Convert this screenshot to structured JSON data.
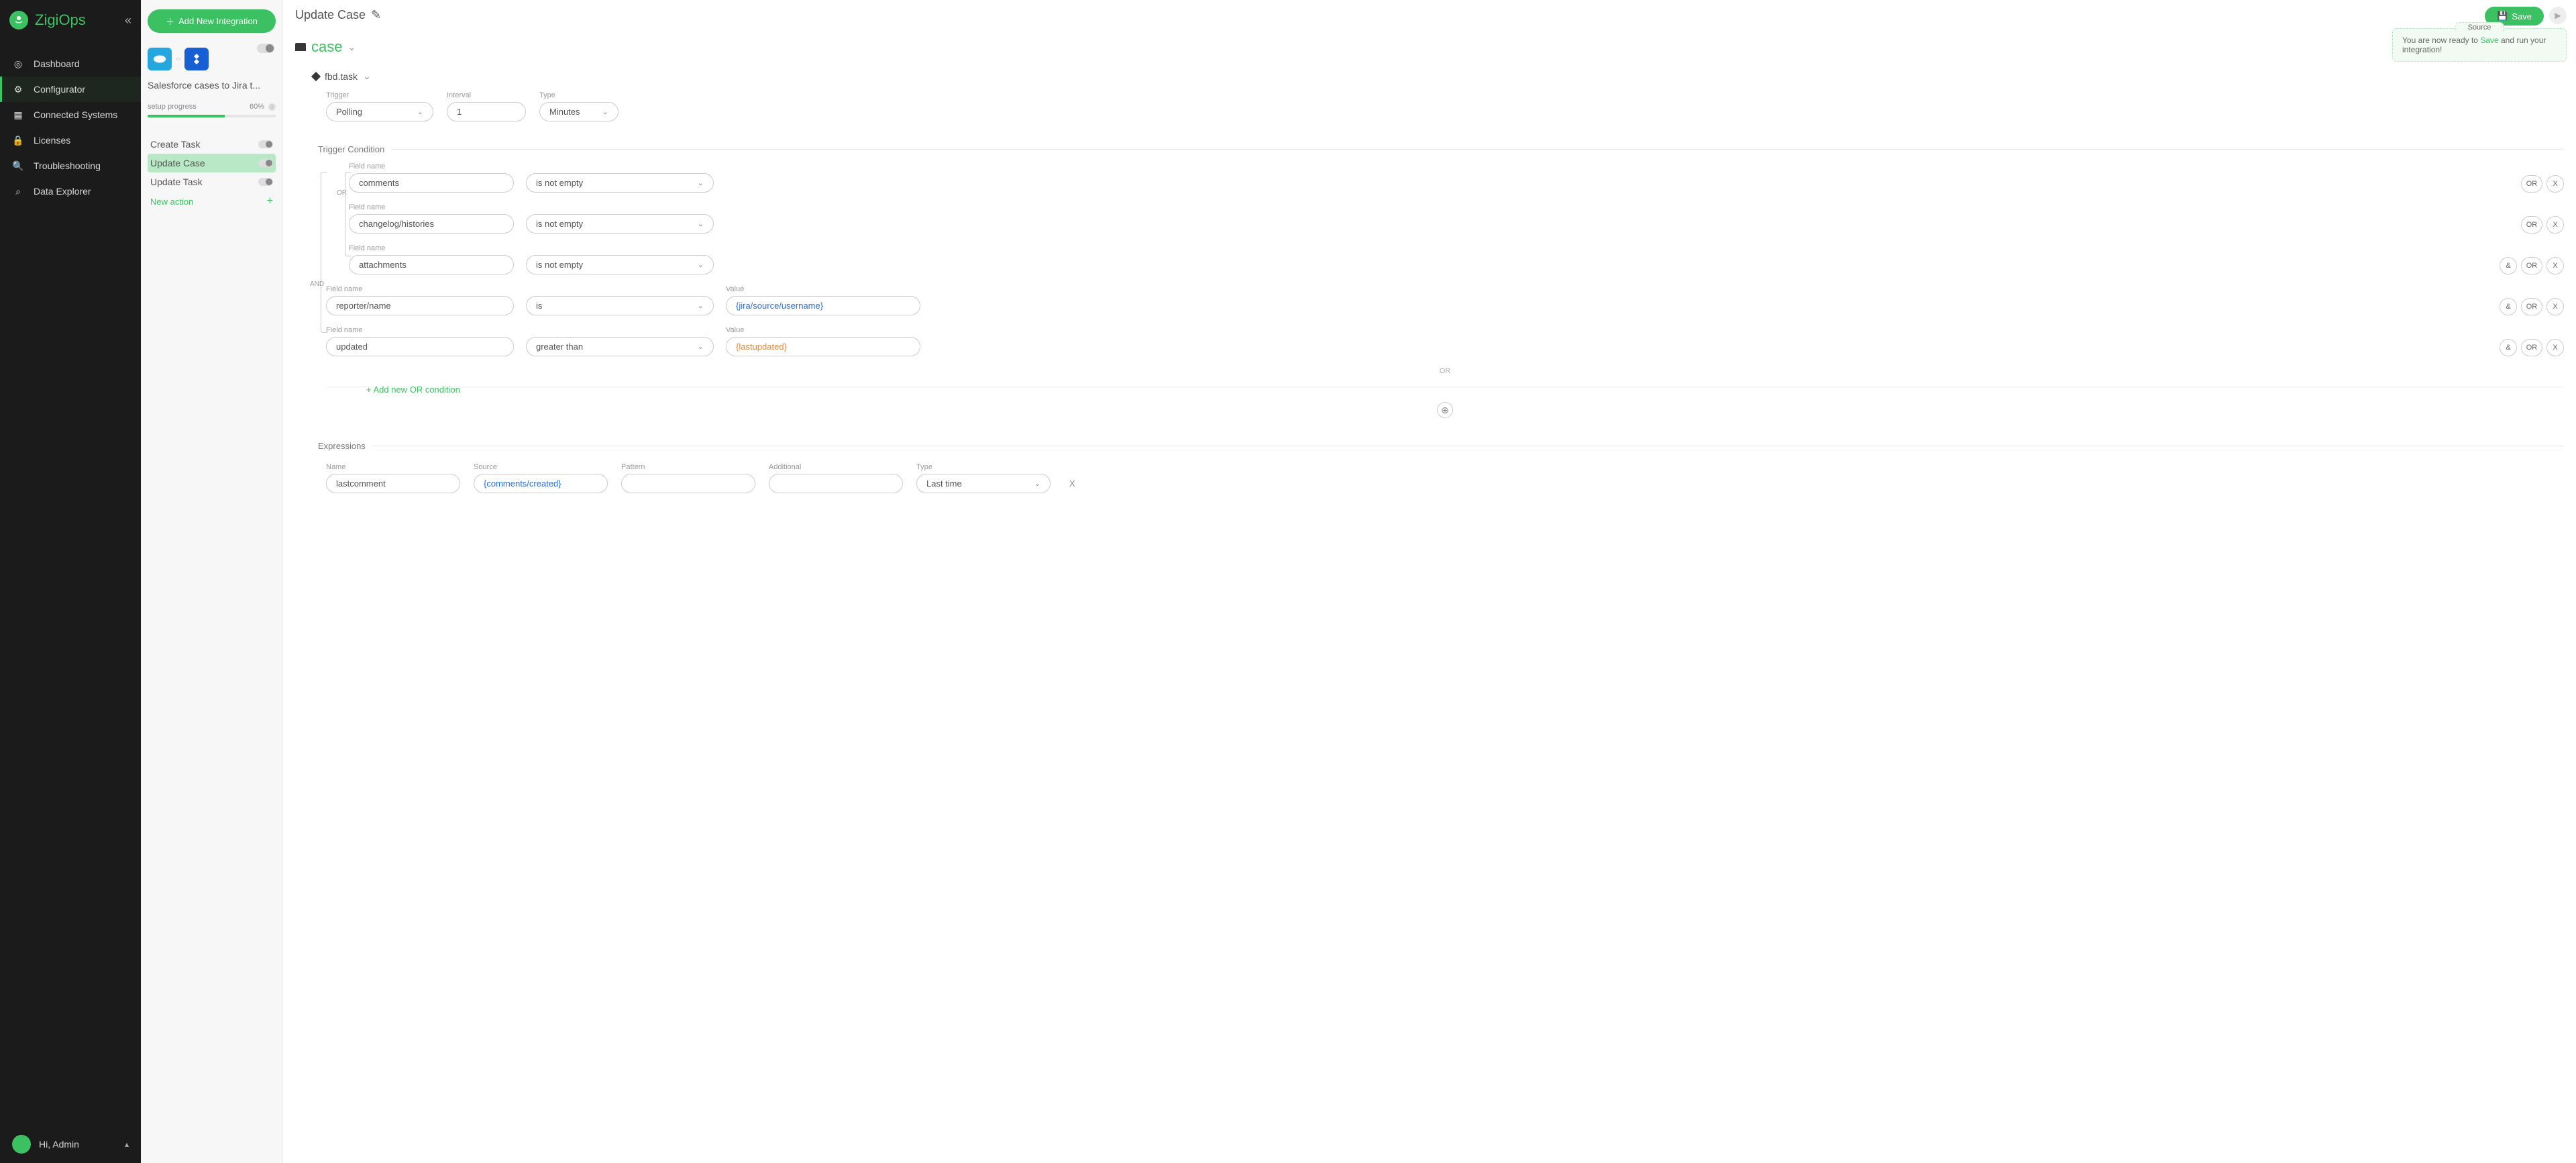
{
  "brand": "ZigiOps",
  "nav": {
    "items": [
      {
        "label": "Dashboard",
        "icon": "target"
      },
      {
        "label": "Configurator",
        "icon": "gear",
        "active": true
      },
      {
        "label": "Connected Systems",
        "icon": "grid"
      },
      {
        "label": "Licenses",
        "icon": "lock"
      },
      {
        "label": "Troubleshooting",
        "icon": "search"
      },
      {
        "label": "Data Explorer",
        "icon": "explore"
      }
    ]
  },
  "user": {
    "greeting": "Hi, Admin"
  },
  "panel": {
    "add_button": "Add New Integration",
    "integration_name": "Salesforce cases to Jira t...",
    "progress_label": "setup progress",
    "progress_pct": "60%",
    "actions": [
      {
        "label": "Create Task"
      },
      {
        "label": "Update Case",
        "active": true
      },
      {
        "label": "Update Task"
      }
    ],
    "new_action": "New action"
  },
  "main": {
    "title": "Update Case",
    "save": "Save",
    "tip_tab": "Source",
    "tip_pre": "You are now ready to ",
    "tip_save": "Save",
    "tip_post": " and run your integration!",
    "entity": "case",
    "sub_entity": "fbd.task",
    "trigger": {
      "trigger_label": "Trigger",
      "trigger_value": "Polling",
      "interval_label": "Interval",
      "interval_value": "1",
      "type_label": "Type",
      "type_value": "Minutes"
    },
    "cond_section": "Trigger Condition",
    "labels": {
      "fieldname": "Field name",
      "value": "Value"
    },
    "logic": {
      "or": "OR",
      "and": "AND"
    },
    "buttons": {
      "and": "&",
      "or": "OR",
      "x": "X"
    },
    "conditions": {
      "or_group": [
        {
          "field": "comments",
          "op": "is not empty"
        },
        {
          "field": "changelog/histories",
          "op": "is not empty"
        },
        {
          "field": "attachments",
          "op": "is not empty"
        }
      ],
      "and_group": [
        {
          "field": "reporter/name",
          "op": "is",
          "value": "{jira/source/username}",
          "vclass": "blue"
        },
        {
          "field": "updated",
          "op": "greater than",
          "value": "{lastupdated}",
          "vclass": "orange"
        }
      ]
    },
    "or_divider": "OR",
    "add_or": "+ Add new OR condition",
    "expr_section": "Expressions",
    "expr": {
      "name_label": "Name",
      "name": "lastcomment",
      "source_label": "Source",
      "source": "{comments/created}",
      "pattern_label": "Pattern",
      "additional_label": "Additional",
      "type_label": "Type",
      "type": "Last time"
    }
  }
}
